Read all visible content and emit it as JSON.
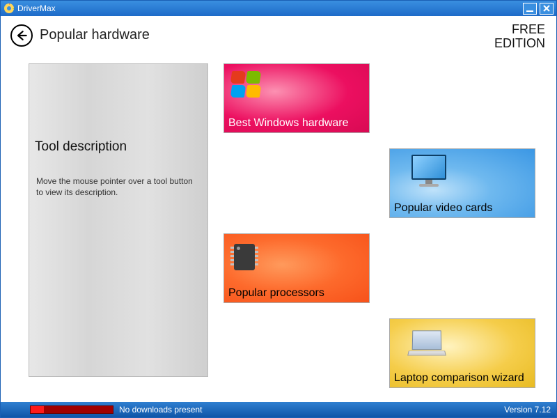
{
  "window": {
    "title": "DriverMax"
  },
  "header": {
    "page_title": "Popular hardware",
    "edition_line1": "FREE",
    "edition_line2": "EDITION"
  },
  "description_panel": {
    "title": "Tool description",
    "body": "Move the mouse pointer over a tool button to view its description."
  },
  "cards": {
    "best_windows_hardware": {
      "label": "Best Windows hardware"
    },
    "popular_video_cards": {
      "label": "Popular video cards"
    },
    "popular_processors": {
      "label": "Popular processors"
    },
    "laptop_comparison": {
      "label": "Laptop comparison wizard"
    }
  },
  "statusbar": {
    "downloads_text": "No downloads present",
    "version_text": "Version 7.12"
  }
}
